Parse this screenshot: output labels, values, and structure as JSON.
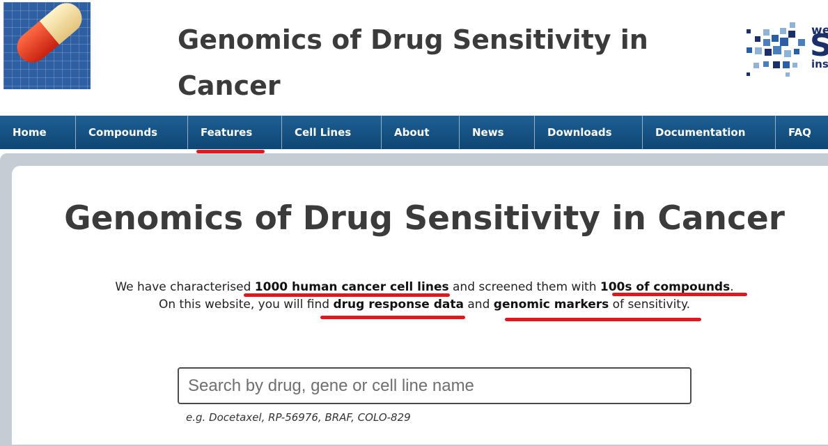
{
  "header": {
    "site_title": "Genomics of Drug Sensitivity in Cancer",
    "partner_logo": {
      "line1": "we",
      "line2": "S",
      "line3": "ins"
    },
    "colors": {
      "logo_blue": "#2f5fa3",
      "partner_navy": "#1b2f6b"
    }
  },
  "nav": {
    "items": [
      {
        "label": "Home"
      },
      {
        "label": "Compounds"
      },
      {
        "label": "Features"
      },
      {
        "label": "Cell Lines"
      },
      {
        "label": "About"
      },
      {
        "label": "News"
      },
      {
        "label": "Downloads"
      },
      {
        "label": "Documentation"
      },
      {
        "label": "FAQ"
      }
    ],
    "colors": {
      "bar": "#1a5588",
      "text": "#ffffff"
    }
  },
  "main": {
    "title": "Genomics of Drug Sensitivity in Cancer",
    "intro": {
      "line1_prefix": "We have characterised ",
      "line1_bold1": "1000 human cancer cell lines",
      "line1_mid": " and screened them with ",
      "line1_bold2": "100s of compounds",
      "line1_suffix": ".",
      "line2_prefix": "On this website, you will find ",
      "line2_bold1": "drug response data",
      "line2_mid": " and ",
      "line2_bold2": "genomic markers",
      "line2_suffix": " of sensitivity."
    },
    "search": {
      "value": "",
      "placeholder": "Search by drug, gene or cell line name",
      "example": "e.g. Docetaxel, RP-56976, BRAF, COLO-829"
    }
  },
  "annotations": {
    "underline_color": "#e0171f"
  }
}
